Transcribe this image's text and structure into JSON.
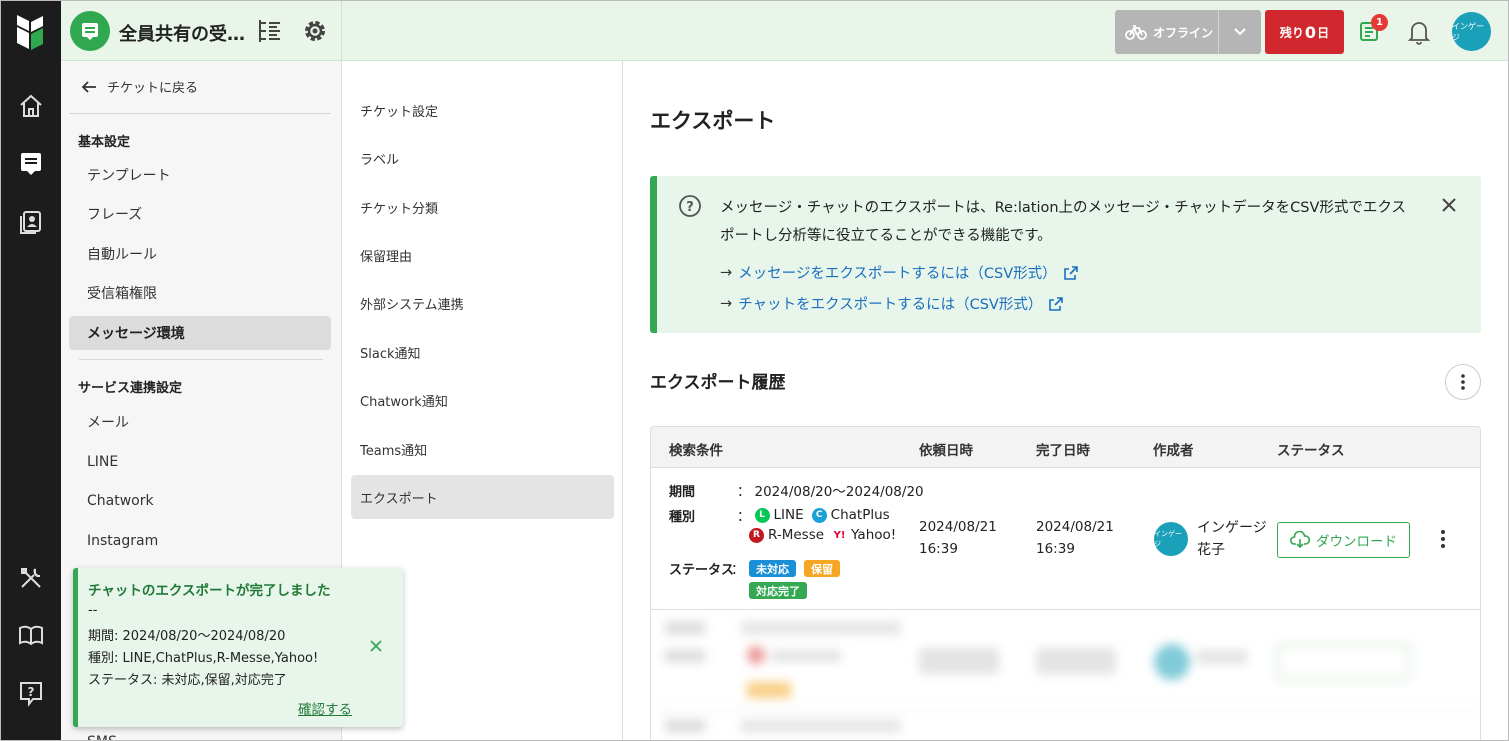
{
  "header": {
    "inbox_name": "全員共有の受…",
    "offline_label": "オフライン",
    "remaining_prefix": "残り",
    "remaining_value": "0",
    "remaining_suffix": "日",
    "ticket_badge_count": "1",
    "avatar_label": "インゲージ"
  },
  "sidebar": {
    "back_label": "チケットに戻る",
    "section_basic": "基本設定",
    "basic_items": [
      "テンプレート",
      "フレーズ",
      "自動ルール",
      "受信箱権限",
      "メッセージ環境"
    ],
    "section_service": "サービス連携設定",
    "service_items": [
      "メール",
      "LINE",
      "Chatwork",
      "Instagram",
      "SMS"
    ]
  },
  "menu": {
    "items": [
      "チケット設定",
      "ラベル",
      "チケット分類",
      "保留理由",
      "外部システム連携",
      "Slack通知",
      "Chatwork通知",
      "Teams通知",
      "エクスポート"
    ]
  },
  "main": {
    "title": "エクスポート",
    "info_text": "メッセージ・チャットのエクスポートは、Re:lation上のメッセージ・チャットデータをCSV形式でエクスポートし分析等に役立てることができる機能です。",
    "link1": "メッセージをエクスポートするには（CSV形式）",
    "link2": "チャットをエクスポートするには（CSV形式）",
    "arrow": "→",
    "history_title": "エクスポート履歴",
    "columns": [
      "検索条件",
      "依頼日時",
      "完了日時",
      "作成者",
      "ステータス"
    ],
    "row": {
      "period_label": "期間",
      "period_value": "2024/08/20〜2024/08/20",
      "kind_label": "種別",
      "kinds": [
        "LINE",
        "ChatPlus",
        "R-Messe",
        "Yahoo!"
      ],
      "status_label": "ステータス",
      "statuses": [
        "未対応",
        "保留",
        "対応完了"
      ],
      "colon": "：",
      "requested_date": "2024/08/21",
      "requested_time": "16:39",
      "completed_date": "2024/08/21",
      "completed_time": "16:39",
      "creator_avatar": "インゲージ",
      "creator_line1": "インゲージ",
      "creator_line2": "花子",
      "download_label": "ダウンロード"
    }
  },
  "toast": {
    "title": "チャットのエクスポートが完了しました",
    "dash": "--",
    "period": "期間: 2024/08/20〜2024/08/20",
    "kinds": "種別: LINE,ChatPlus,R-Messe,Yahoo!",
    "status": "ステータス: 未対応,保留,対応完了",
    "confirm": "確認する"
  },
  "colors": {
    "brand_green": "#34a853",
    "danger_red": "#d0282e",
    "link_blue": "#1a6fbf",
    "tag_unhandled": "#1a8fd8",
    "tag_hold": "#f5a623",
    "tag_done": "#34a853"
  }
}
